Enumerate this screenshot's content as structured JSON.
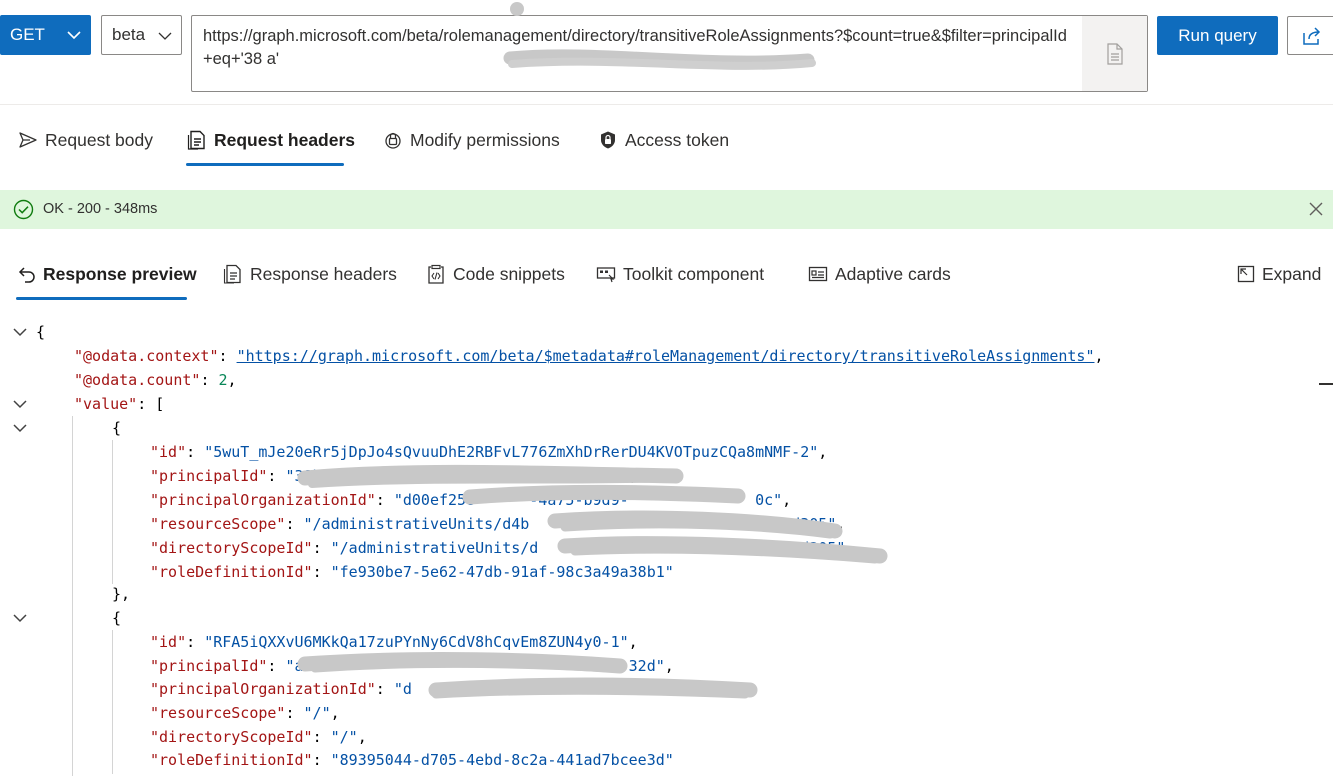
{
  "query": {
    "method": "GET",
    "version": "beta",
    "url": "https://graph.microsoft.com/beta/rolemanagement/directory/transitiveRoleAssignments?$count=true&$filter=principalId+eq+'38                                        a'",
    "run_label": "Run query"
  },
  "request_tabs": [
    {
      "label": "Request body"
    },
    {
      "label": "Request headers"
    },
    {
      "label": "Modify permissions"
    },
    {
      "label": "Access token"
    }
  ],
  "status": {
    "text": "OK - 200 - 348ms"
  },
  "response_tabs": [
    {
      "label": "Response preview"
    },
    {
      "label": "Response headers"
    },
    {
      "label": "Code snippets"
    },
    {
      "label": "Toolkit component"
    },
    {
      "label": "Adaptive cards"
    }
  ],
  "expand_label": "Expand",
  "response": {
    "context_key": "\"@odata.context\"",
    "context_value": "\"https://graph.microsoft.com/beta/$metadata#roleManagement/directory/transitiveRoleAssignments\"",
    "count_key": "\"@odata.count\"",
    "count_value": "2",
    "value_key": "\"value\"",
    "items": [
      {
        "id": "\"5wuT_mJe20eRr5jDpJo4sQvuuDhE2RBFvL776ZmXhDrRerDU4KVOTpuzCQa8mNMF-2\"",
        "principalId": "\"38b8ee0b-d044-4510-b4ea-fbe00007843a\"",
        "principalOrganizationId": "\"d00ef258-     -4a75-b9d9-              0c\"",
        "resourceScope": "\"/administrativeUnits/d4b                          e98d305\"",
        "directoryScopeId": "\"/administrativeUnits/d                          e98d305\"",
        "roleDefinitionId": "\"fe930be7-5e62-47db-91af-98c3a49a38b1\""
      },
      {
        "id": "\"RFA5iQXXvU6MKkQa17zuPYnNy6CdV8hCqvEm8ZUN4y0-1\"",
        "principalId": "\"a0                                   32d\"",
        "principalOrganizationId": "\"d        -1b2                     0c\"",
        "resourceScope": "\"/\"",
        "directoryScopeId": "\"/\"",
        "roleDefinitionId": "\"89395044-d705-4ebd-8c2a-441ad7bcee3d\""
      }
    ]
  },
  "colors": {
    "accent": "#0f6cbd",
    "status_bg": "#dff6dd",
    "json_key": "#a31515",
    "json_string": "#0451a5",
    "json_number": "#098658"
  }
}
